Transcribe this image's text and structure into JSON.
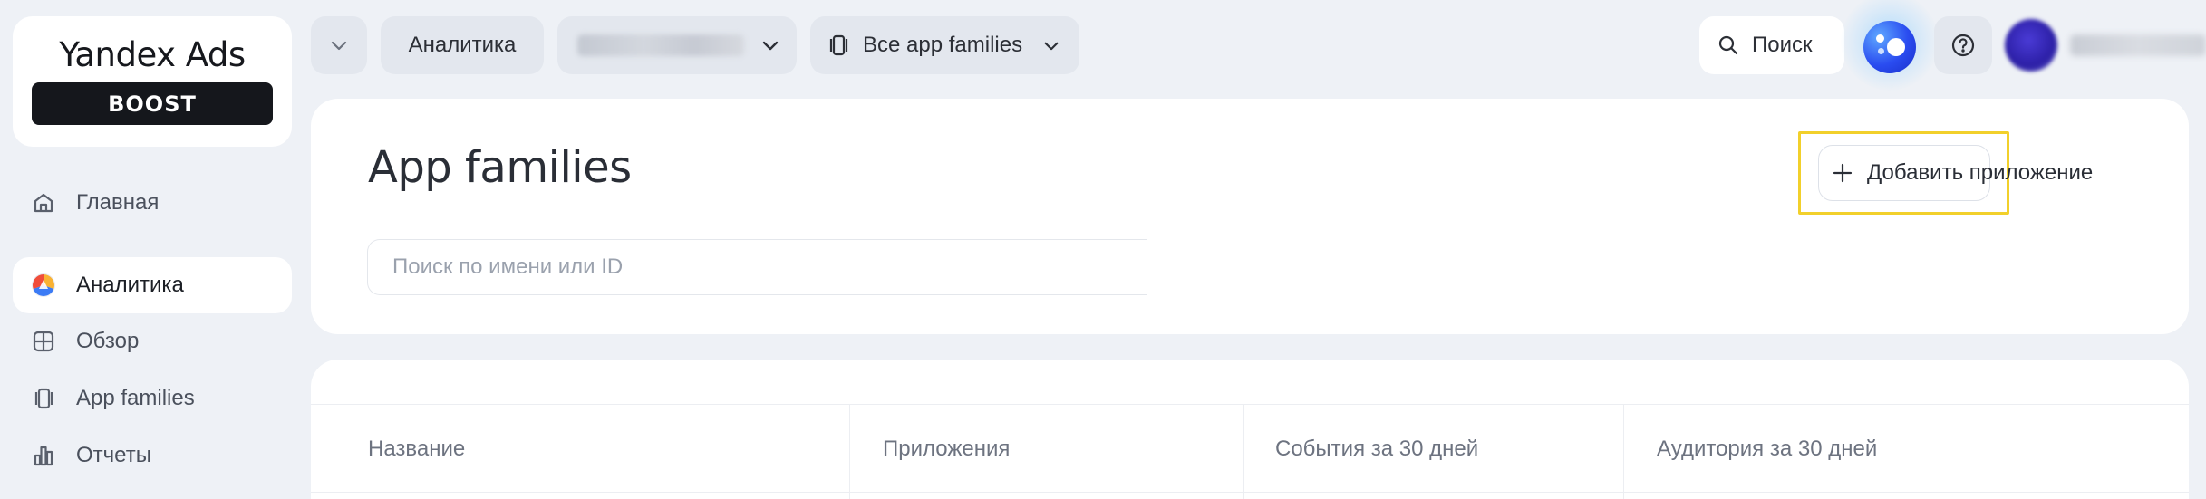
{
  "logo": {
    "title": "Yandex Ads",
    "badge": "BOOST"
  },
  "sidebar": {
    "items": [
      {
        "label": "Главная",
        "icon": "home-icon",
        "active": false
      },
      {
        "label": "Аналитика",
        "icon": "analytics-logo-icon",
        "active": true
      },
      {
        "label": "Обзор",
        "icon": "grid-icon",
        "active": false
      },
      {
        "label": "App families",
        "icon": "app-families-icon",
        "active": false
      },
      {
        "label": "Отчеты",
        "icon": "reports-chart-icon",
        "active": false
      }
    ]
  },
  "topbar": {
    "collapse_icon": "chevron-down-icon",
    "analytics_label": "Аналитика",
    "families_label": "Все app families",
    "search_label": "Поиск"
  },
  "main": {
    "title": "App families",
    "search_placeholder": "Поиск по имени или ID",
    "add_button_label": "Добавить приложение"
  },
  "table": {
    "columns": [
      "Название",
      "Приложения",
      "События за 30 дней",
      "Аудитория за 30 дней"
    ]
  },
  "colors": {
    "background": "#eef1f6",
    "card": "#ffffff",
    "pill": "#e3e7ee",
    "highlight": "#f2d02b",
    "logo_badge": "#15171c"
  }
}
